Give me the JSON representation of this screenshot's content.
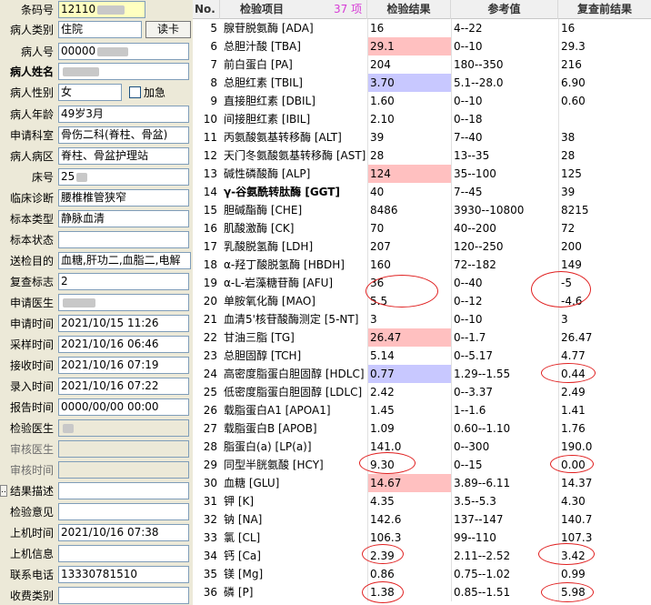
{
  "form": {
    "barcode_label": "条码号",
    "barcode_value": "12110",
    "patient_type_label": "病人类别",
    "patient_type_value": "住院",
    "read_card_label": "读卡",
    "patient_no_label": "病人号",
    "patient_no_value": "00000",
    "patient_name_label": "病人姓名",
    "patient_name_value": "",
    "patient_sex_label": "病人性别",
    "patient_sex_value": "女",
    "urgent_label": "加急",
    "patient_age_label": "病人年龄",
    "patient_age_value": "49岁3月",
    "dept_label": "申请科室",
    "dept_value": "骨伤二科(脊柱、骨盆)",
    "ward_label": "病人病区",
    "ward_value": "脊柱、骨盆护理站",
    "bed_label": "床号",
    "bed_value": "25",
    "diagnosis_label": "临床诊断",
    "diagnosis_value": "腰椎椎管狭窄",
    "specimen_label": "标本类型",
    "specimen_value": "静脉血清",
    "specimen_status_label": "标本状态",
    "specimen_status_value": "",
    "test_items_label": "送检目的",
    "test_items_value": "血糖,肝功二,血脂二,电解",
    "recheck_label": "复查标志",
    "recheck_value": "2",
    "requesting_doctor_label": "申请医生",
    "requesting_doctor_value": "",
    "request_time_label": "申请时间",
    "request_time_value": "2021/10/15 11:26",
    "collect_time_label": "采样时间",
    "collect_time_value": "2021/10/16 06:46",
    "receive_time_label": "接收时间",
    "receive_time_value": "2021/10/16 07:19",
    "entry_time_label": "录入时间",
    "entry_time_value": "2021/10/16 07:22",
    "report_time_label": "报告时间",
    "report_time_value": "0000/00/00 00:00",
    "test_doctor_label": "检验医生",
    "test_doctor_value": "",
    "review_doctor_label": "审核医生",
    "review_doctor_value": "",
    "review_time_label": "审核时间",
    "review_time_value": "",
    "result_desc_label": "结果描述",
    "result_desc_btn": "..",
    "opinion_label": "检验意见",
    "opinion_value": "",
    "machine_time_label": "上机时间",
    "machine_time_value": "2021/10/16 07:38",
    "machine_info_label": "上机信息",
    "machine_info_value": "",
    "phone_label": "联系电话",
    "phone_value": "13330781510",
    "charge_type_label": "收费类别",
    "charge_type_value": ""
  },
  "table": {
    "col_no": "No.",
    "col_item": "检验项目",
    "count": "37 项",
    "col_result": "检验结果",
    "col_ref": "参考值",
    "col_prev": "复查前结果",
    "rows": [
      {
        "no": "5",
        "item": "腺苷脱氨酶 [ADA]",
        "result": "16",
        "flag": "",
        "ref": "4--22",
        "prev": "16"
      },
      {
        "no": "6",
        "item": "总胆汁酸 [TBA]",
        "result": "29.1",
        "flag": "hi",
        "ref": "0--10",
        "prev": "29.3"
      },
      {
        "no": "7",
        "item": "前白蛋白 [PA]",
        "result": "204",
        "flag": "",
        "ref": "180--350",
        "prev": "216"
      },
      {
        "no": "8",
        "item": "总胆红素 [TBIL]",
        "result": "3.70",
        "flag": "lo",
        "ref": "5.1--28.0",
        "prev": "6.90"
      },
      {
        "no": "9",
        "item": "直接胆红素 [DBIL]",
        "result": "1.60",
        "flag": "",
        "ref": "0--10",
        "prev": "0.60"
      },
      {
        "no": "10",
        "item": "间接胆红素 [IBIL]",
        "result": "2.10",
        "flag": "",
        "ref": "0--18",
        "prev": ""
      },
      {
        "no": "11",
        "item": "丙氨酸氨基转移酶 [ALT]",
        "result": "39",
        "flag": "",
        "ref": "7--40",
        "prev": "38"
      },
      {
        "no": "12",
        "item": "天门冬氨酸氨基转移酶 [AST]",
        "result": "28",
        "flag": "",
        "ref": "13--35",
        "prev": "28"
      },
      {
        "no": "13",
        "item": "碱性磷酸酶 [ALP]",
        "result": "124",
        "flag": "hi",
        "ref": "35--100",
        "prev": "125"
      },
      {
        "no": "14",
        "item": "γ-谷氨酰转肽酶 [GGT]",
        "result": "40",
        "flag": "",
        "ref": "7--45",
        "prev": "39",
        "bold": true
      },
      {
        "no": "15",
        "item": "胆碱酯酶 [CHE]",
        "result": "8486",
        "flag": "",
        "ref": "3930--10800",
        "prev": "8215"
      },
      {
        "no": "16",
        "item": "肌酸激酶 [CK]",
        "result": "70",
        "flag": "",
        "ref": "40--200",
        "prev": "72"
      },
      {
        "no": "17",
        "item": "乳酸脱氢酶 [LDH]",
        "result": "207",
        "flag": "",
        "ref": "120--250",
        "prev": "200"
      },
      {
        "no": "18",
        "item": "α-羟丁酸脱氢酶 [HBDH]",
        "result": "160",
        "flag": "",
        "ref": "72--182",
        "prev": "149"
      },
      {
        "no": "19",
        "item": "α-L-岩藻糖苷酶 [AFU]",
        "result": "36",
        "flag": "",
        "ref": "0--40",
        "prev": "-5"
      },
      {
        "no": "20",
        "item": "单胺氧化酶 [MAO]",
        "result": "5.5",
        "flag": "",
        "ref": "0--12",
        "prev": "-4.6"
      },
      {
        "no": "21",
        "item": "血清5'核苷酸酶测定 [5-NT]",
        "result": "3",
        "flag": "",
        "ref": "0--10",
        "prev": "3"
      },
      {
        "no": "22",
        "item": "甘油三脂 [TG]",
        "result": "26.47",
        "flag": "hi",
        "ref": "0--1.7",
        "prev": "26.47"
      },
      {
        "no": "23",
        "item": "总胆固醇 [TCH]",
        "result": "5.14",
        "flag": "",
        "ref": "0--5.17",
        "prev": "4.77"
      },
      {
        "no": "24",
        "item": "高密度脂蛋白胆固醇 [HDLC]",
        "result": "0.77",
        "flag": "lo",
        "ref": "1.29--1.55",
        "prev": "0.44"
      },
      {
        "no": "25",
        "item": "低密度脂蛋白胆固醇 [LDLC]",
        "result": "2.42",
        "flag": "",
        "ref": "0--3.37",
        "prev": "2.49"
      },
      {
        "no": "26",
        "item": "载脂蛋白A1 [APOA1]",
        "result": "1.45",
        "flag": "",
        "ref": "1--1.6",
        "prev": "1.41"
      },
      {
        "no": "27",
        "item": "载脂蛋白B [APOB]",
        "result": "1.09",
        "flag": "",
        "ref": "0.60--1.10",
        "prev": "1.76"
      },
      {
        "no": "28",
        "item": "脂蛋白(a) [LP(a)]",
        "result": "141.0",
        "flag": "",
        "ref": "0--300",
        "prev": "190.0"
      },
      {
        "no": "29",
        "item": "同型半胱氨酸 [HCY]",
        "result": "9.30",
        "flag": "",
        "ref": "0--15",
        "prev": "0.00"
      },
      {
        "no": "30",
        "item": "血糖 [GLU]",
        "result": "14.67",
        "flag": "hi",
        "ref": "3.89--6.11",
        "prev": "14.37"
      },
      {
        "no": "31",
        "item": "钾 [K]",
        "result": "4.35",
        "flag": "",
        "ref": "3.5--5.3",
        "prev": "4.30"
      },
      {
        "no": "32",
        "item": "钠 [NA]",
        "result": "142.6",
        "flag": "",
        "ref": "137--147",
        "prev": "140.7"
      },
      {
        "no": "33",
        "item": "氯 [CL]",
        "result": "106.3",
        "flag": "",
        "ref": "99--110",
        "prev": "107.3"
      },
      {
        "no": "34",
        "item": "钙 [Ca]",
        "result": "2.39",
        "flag": "",
        "ref": "2.11--2.52",
        "prev": "3.42"
      },
      {
        "no": "35",
        "item": "镁 [Mg]",
        "result": "0.86",
        "flag": "",
        "ref": "0.75--1.02",
        "prev": "0.99"
      },
      {
        "no": "36",
        "item": "磷 [P]",
        "result": "1.38",
        "flag": "",
        "ref": "0.85--1.51",
        "prev": "5.98"
      }
    ]
  }
}
